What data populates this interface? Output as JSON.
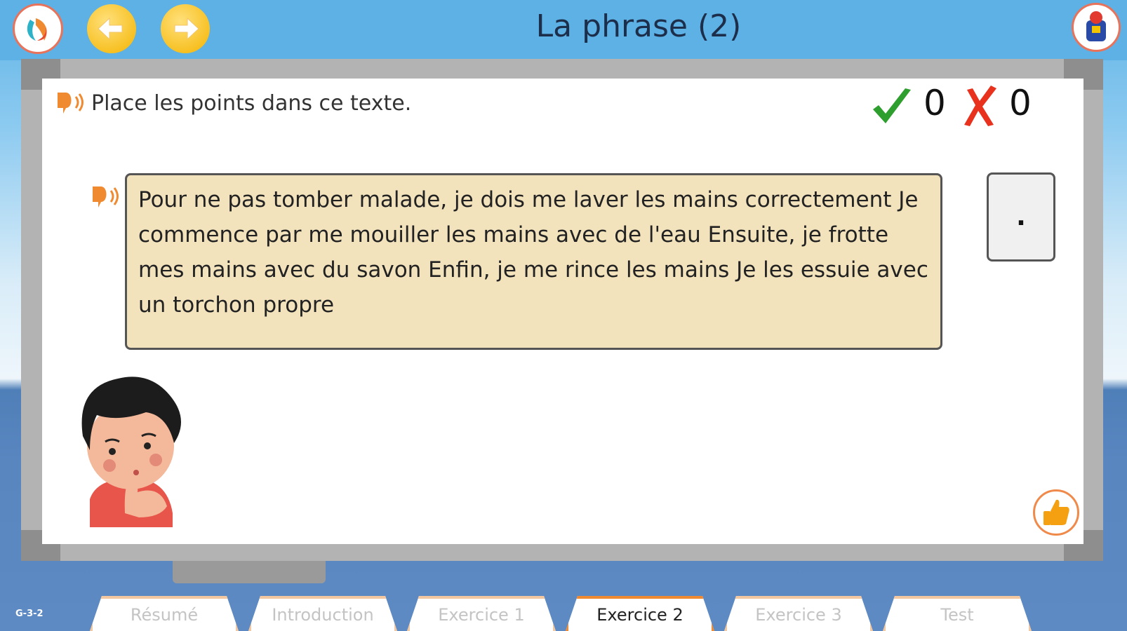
{
  "header": {
    "title": "La phrase (2)",
    "logo_icon": "app-logo-icon",
    "prev_icon": "arrow-left-icon",
    "next_icon": "arrow-right-icon",
    "profile_icon": "student-avatar-icon"
  },
  "instruction": {
    "text": "Place les points dans ce texte."
  },
  "score": {
    "correct": "0",
    "wrong": "0"
  },
  "exercise": {
    "passage": "Pour ne pas tomber malade, je dois me laver les mains correctement Je commence par me mouiller les mains avec de l'eau Ensuite, je frotte mes mains avec du savon Enfin, je me rince les mains Je les essuie avec un torchon propre",
    "draggable_token": "."
  },
  "footer": {
    "version": "G-3-2",
    "tabs": [
      {
        "label": "Résumé",
        "active": false
      },
      {
        "label": "Introduction",
        "active": false
      },
      {
        "label": "Exercice 1",
        "active": false
      },
      {
        "label": "Exercice 2",
        "active": true
      },
      {
        "label": "Exercice 3",
        "active": false
      },
      {
        "label": "Test",
        "active": false
      }
    ]
  },
  "colors": {
    "accent": "#f08a30",
    "correct": "#2e9e2e",
    "wrong": "#e8321e",
    "passage_bg": "#f3e3bd"
  }
}
